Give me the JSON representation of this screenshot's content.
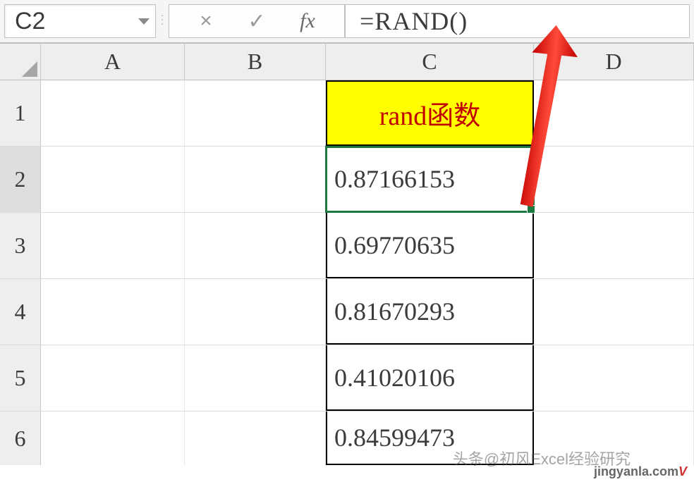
{
  "formula_bar": {
    "name_box": "C2",
    "cancel_glyph": "×",
    "confirm_glyph": "✓",
    "fx_label": "fx",
    "formula_value": "=RAND()"
  },
  "columns": {
    "A": "A",
    "B": "B",
    "C": "C",
    "D": "D"
  },
  "rows": {
    "r1": "1",
    "r2": "2",
    "r3": "3",
    "r4": "4",
    "r5": "5",
    "r6": "6"
  },
  "data": {
    "c1": "rand函数",
    "c2": "0.87166153",
    "c3": "0.69770635",
    "c4": "0.81670293",
    "c5": "0.41020106",
    "c6": "0.84599473"
  },
  "watermark": {
    "line1": "头条@初风Excel经验研究",
    "line2": "jingyanla.com"
  }
}
